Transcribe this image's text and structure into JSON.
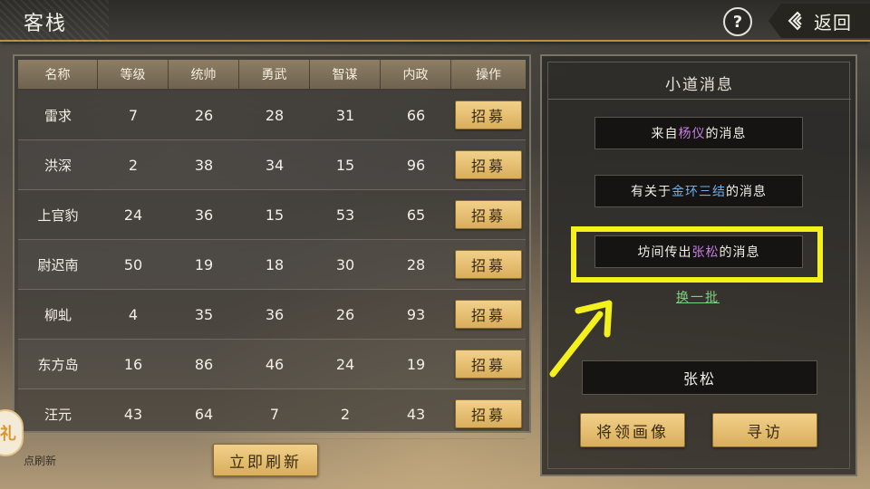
{
  "header": {
    "title": "客栈",
    "help_label": "?",
    "back_label": "返回"
  },
  "recruit_table": {
    "columns": [
      "名称",
      "等级",
      "统帅",
      "勇武",
      "智谋",
      "内政",
      "操作"
    ],
    "rows": [
      {
        "name": "雷求",
        "level": "7",
        "command": "26",
        "valor": "28",
        "strategy": "31",
        "politics": "66",
        "action": "招募"
      },
      {
        "name": "洪深",
        "level": "2",
        "command": "38",
        "valor": "34",
        "strategy": "15",
        "politics": "96",
        "action": "招募"
      },
      {
        "name": "上官豹",
        "level": "24",
        "command": "36",
        "valor": "15",
        "strategy": "53",
        "politics": "65",
        "action": "招募"
      },
      {
        "name": "尉迟南",
        "level": "50",
        "command": "19",
        "valor": "18",
        "strategy": "30",
        "politics": "28",
        "action": "招募"
      },
      {
        "name": "柳虬",
        "level": "4",
        "command": "35",
        "valor": "36",
        "strategy": "26",
        "politics": "93",
        "action": "招募"
      },
      {
        "name": "东方岛",
        "level": "16",
        "command": "86",
        "valor": "46",
        "strategy": "24",
        "politics": "19",
        "action": "招募"
      },
      {
        "name": "汪元",
        "level": "43",
        "command": "64",
        "valor": "7",
        "strategy": "2",
        "politics": "43",
        "action": "招募"
      }
    ]
  },
  "footer": {
    "refresh_label": "立即刷新",
    "auto_refresh_text": "点刷新",
    "side_badge_text": "礼"
  },
  "news_panel": {
    "title": "小道消息",
    "messages": [
      {
        "prefix": "来自",
        "highlight": "杨仪",
        "suffix": "的消息",
        "highlight_color": "#c77ee0"
      },
      {
        "prefix": "有关于",
        "highlight": "金环三结",
        "suffix": "的消息",
        "highlight_color": "#6fb0e8"
      },
      {
        "prefix": "坊间传出",
        "highlight": "张松",
        "suffix": "的消息",
        "highlight_color": "#c77ee0"
      }
    ],
    "switch_label": "换一批",
    "selected_name": "张松",
    "portrait_button": "将领画像",
    "visit_button": "寻访"
  },
  "annotation": {
    "highlight_color": "#f4f01c"
  }
}
